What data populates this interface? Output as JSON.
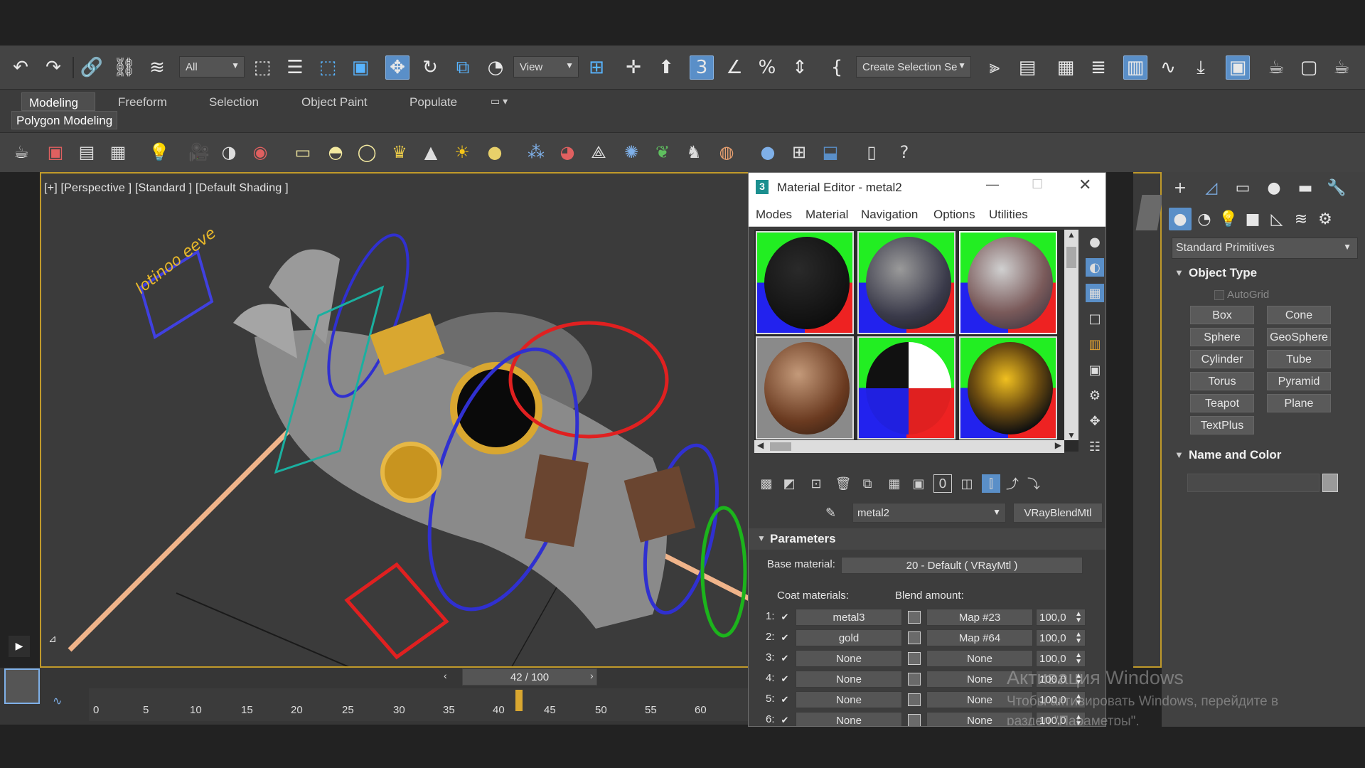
{
  "toolbar": {
    "selection_filter": "All",
    "ref_coord": "View",
    "named_selection": "Create Selection Se"
  },
  "ribbon": {
    "tabs": [
      "Modeling",
      "Freeform",
      "Selection",
      "Object Paint",
      "Populate"
    ],
    "active_tab": "Modeling",
    "subtab": "Polygon Modeling"
  },
  "viewport": {
    "label": "[+] [Perspective ] [Standard ] [Default Shading ]",
    "scene_text": "lotinoo eeve"
  },
  "timeline": {
    "frame": "42 / 100",
    "ticks": [
      "0",
      "5",
      "10",
      "15",
      "20",
      "25",
      "30",
      "35",
      "40",
      "45",
      "50",
      "55",
      "60"
    ]
  },
  "material_editor": {
    "title": "Material Editor - metal2",
    "app_icon_text": "3",
    "menu": [
      "Modes",
      "Material",
      "Navigation",
      "Options",
      "Utilities"
    ],
    "material_name": "metal2",
    "material_type": "VRayBlendMtl",
    "parameters_header": "Parameters",
    "base_material_label": "Base material:",
    "base_material_value": "20 - Default  ( VRayMtl )",
    "coat_header": "Coat materials:",
    "blend_header": "Blend amount:",
    "rows": [
      {
        "index": "1:",
        "coat": "metal3",
        "map": "Map #23",
        "amount": "100,0"
      },
      {
        "index": "2:",
        "coat": "gold",
        "map": "Map #64",
        "amount": "100,0"
      },
      {
        "index": "3:",
        "coat": "None",
        "map": "None",
        "amount": "100,0"
      },
      {
        "index": "4:",
        "coat": "None",
        "map": "None",
        "amount": "100,0"
      },
      {
        "index": "5:",
        "coat": "None",
        "map": "None",
        "amount": "100,0"
      },
      {
        "index": "6:",
        "coat": "None",
        "map": "None",
        "amount": "100,0"
      }
    ]
  },
  "command_panel": {
    "category": "Standard Primitives",
    "object_type_header": "Object Type",
    "autogrid": "AutoGrid",
    "primitives": [
      "Box",
      "Cone",
      "Sphere",
      "GeoSphere",
      "Cylinder",
      "Tube",
      "Torus",
      "Pyramid",
      "Teapot",
      "Plane",
      "TextPlus"
    ],
    "name_color_header": "Name and Color"
  },
  "watermark": {
    "line1": "Активация Windows",
    "line2": "Чтобы активировать Windows, перейдите в",
    "line3": "раздел \"Параметры\"."
  },
  "colors": {
    "accent": "#5a8fc8",
    "viewport_border": "#c09a2a",
    "panel_bg": "#414141"
  }
}
